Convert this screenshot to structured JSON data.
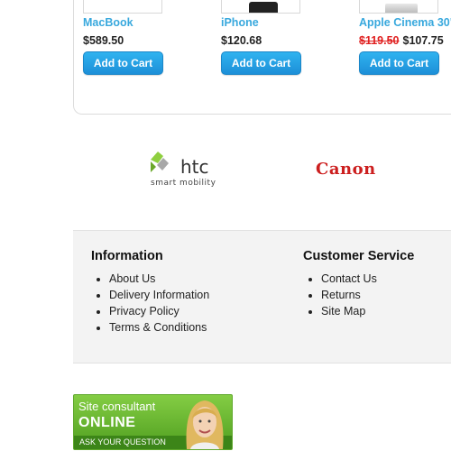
{
  "products": [
    {
      "name": "MacBook",
      "price": "$589.50",
      "old_price": "",
      "button": "Add to Cart"
    },
    {
      "name": "iPhone",
      "price": "$120.68",
      "old_price": "",
      "button": "Add to Cart"
    },
    {
      "name": "Apple Cinema 30\"",
      "price": "$107.75",
      "old_price": "$119.50",
      "button": "Add to Cart"
    }
  ],
  "brands": {
    "htc_text": "htc",
    "htc_tagline": "smart mobility",
    "canon": "Canon"
  },
  "footer": {
    "information": {
      "title": "Information",
      "links": [
        "About Us",
        "Delivery Information",
        "Privacy Policy",
        "Terms & Conditions"
      ]
    },
    "customer_service": {
      "title": "Customer Service",
      "links": [
        "Contact Us",
        "Returns",
        "Site Map"
      ]
    }
  },
  "consultant": {
    "line1": "Site consultant",
    "line2": "ONLINE",
    "line3": "ASK YOUR QUESTION"
  },
  "colors": {
    "link_blue": "#38a8dd",
    "button_blue": "#1d8fd8",
    "sale_red": "#e02020",
    "canon_red": "#cc1f1f",
    "consultant_green": "#6cb832"
  },
  "icons": [
    "macbook-thumbnail",
    "iphone-thumbnail",
    "cinema-display-thumbnail",
    "htc-logo",
    "canon-logo",
    "consultant-photo"
  ]
}
